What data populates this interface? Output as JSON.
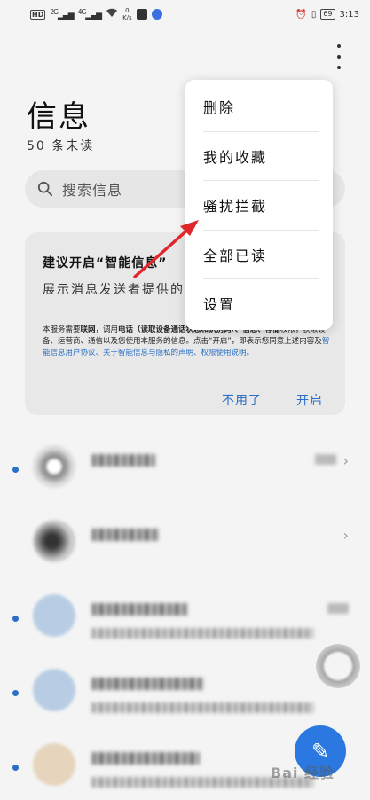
{
  "status_bar": {
    "hd": "HD",
    "net1": "2G",
    "net2": "4G",
    "speed_value": "0",
    "speed_unit": "K/s",
    "battery": "69",
    "time": "3:13"
  },
  "header": {
    "title": "信息",
    "unread_count": "50 条未读"
  },
  "search": {
    "placeholder": "搜索信息"
  },
  "suggestion_card": {
    "title": "建议开启“智能信息”",
    "desc": "展示消息发送者提供的 的消息展示方式。",
    "fine_print_1": "本服务需要",
    "fine_print_network": "联网",
    "fine_print_2": "，调用",
    "fine_print_phone": "电话（读取设备通话状态和识别码）、信息、存储",
    "fine_print_3": "权限，获取设备、运营商、通信以及您使用本服务的信息。点击“开启”，即表示您同意上述内容及",
    "fine_print_link": "智能信息用户协议、关于智能信息与隐私的声明、权限使用说明。",
    "btn_decline": "不用了",
    "btn_enable": "开启"
  },
  "menu": {
    "items": [
      {
        "label": "删除"
      },
      {
        "label": "我的收藏"
      },
      {
        "label": "骚扰拦截"
      },
      {
        "label": "全部已读"
      },
      {
        "label": "设置"
      }
    ]
  },
  "fab": {
    "icon": "new-message-icon"
  },
  "watermark": {
    "text": "Bai 经验"
  },
  "colors": {
    "accent": "#2b6fc6",
    "arrow": "#e0262b",
    "background": "#f4f4f4"
  }
}
